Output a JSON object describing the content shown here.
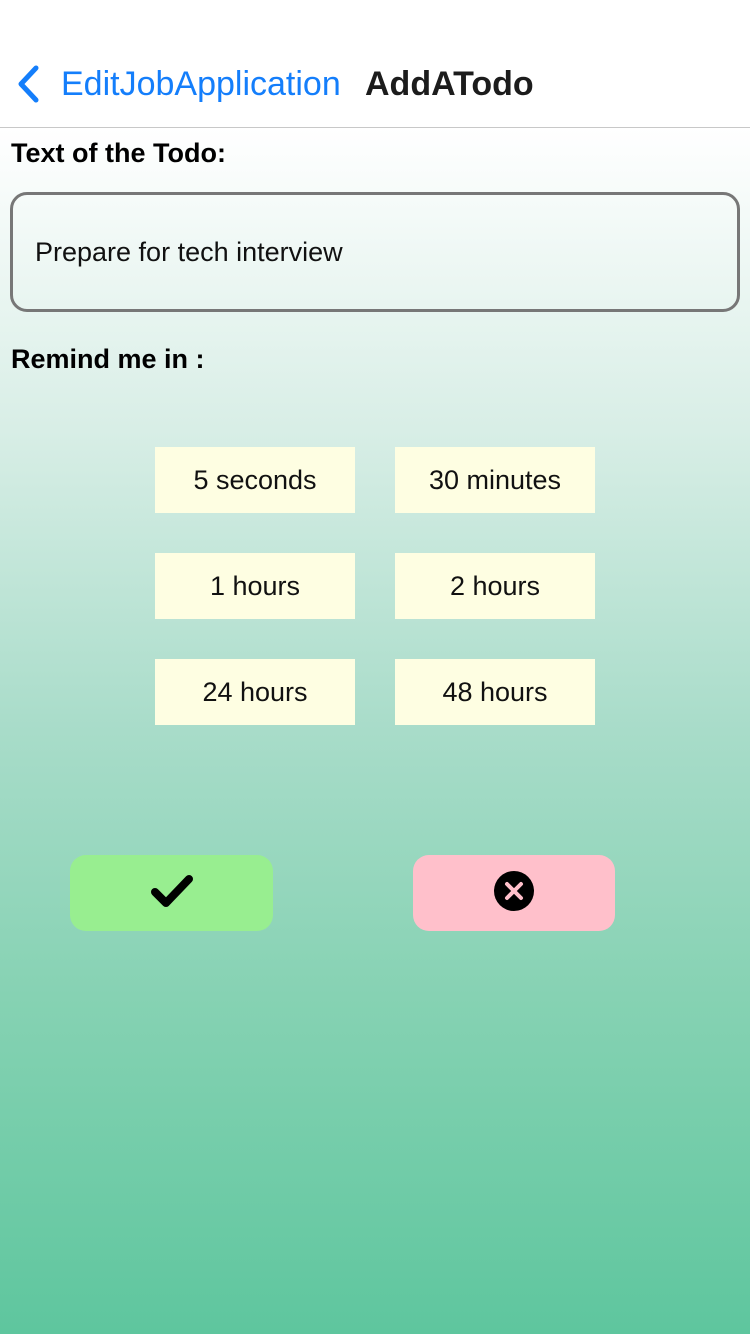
{
  "nav": {
    "back_label": "EditJobApplication",
    "title": "AddATodo",
    "back_icon": "chevron-left-icon",
    "accent_color": "#147efb"
  },
  "form": {
    "todo_label": "Text of the Todo:",
    "todo_value": "Prepare for tech interview",
    "remind_label": "Remind me in :"
  },
  "reminders": [
    {
      "label": "5 seconds"
    },
    {
      "label": "30 minutes"
    },
    {
      "label": "1 hours"
    },
    {
      "label": "2 hours"
    },
    {
      "label": "24 hours"
    },
    {
      "label": "48 hours"
    }
  ],
  "actions": {
    "confirm_icon": "checkmark-icon",
    "cancel_icon": "close-circle-icon",
    "confirm_color": "#98ee90",
    "cancel_color": "#ffc0cb"
  },
  "colors": {
    "reminder_button": "#fefee2",
    "gradient_bottom": "#5ec69e"
  }
}
